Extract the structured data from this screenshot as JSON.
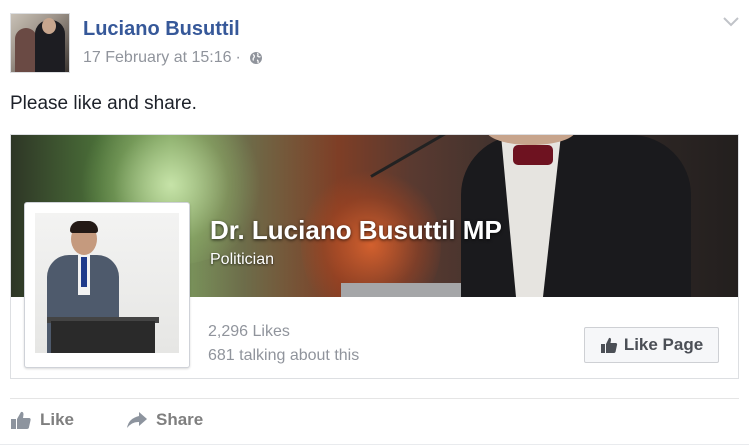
{
  "post": {
    "author": "Luciano Busuttil",
    "timestamp": "17 February at 15:16",
    "separator": "·",
    "privacy_icon": "globe-icon",
    "text": "Please like and share."
  },
  "page_card": {
    "name": "Dr. Luciano Busuttil MP",
    "category": "Politician",
    "likes": "2,296 Likes",
    "talking": "681 talking about this",
    "like_button_label": "Like Page",
    "like_button_icon": "thumbs-up-icon"
  },
  "actions": {
    "like_label": "Like",
    "share_label": "Share"
  },
  "colors": {
    "author_link": "#365899",
    "meta_text": "#90949c",
    "body_text": "#1d2129"
  }
}
